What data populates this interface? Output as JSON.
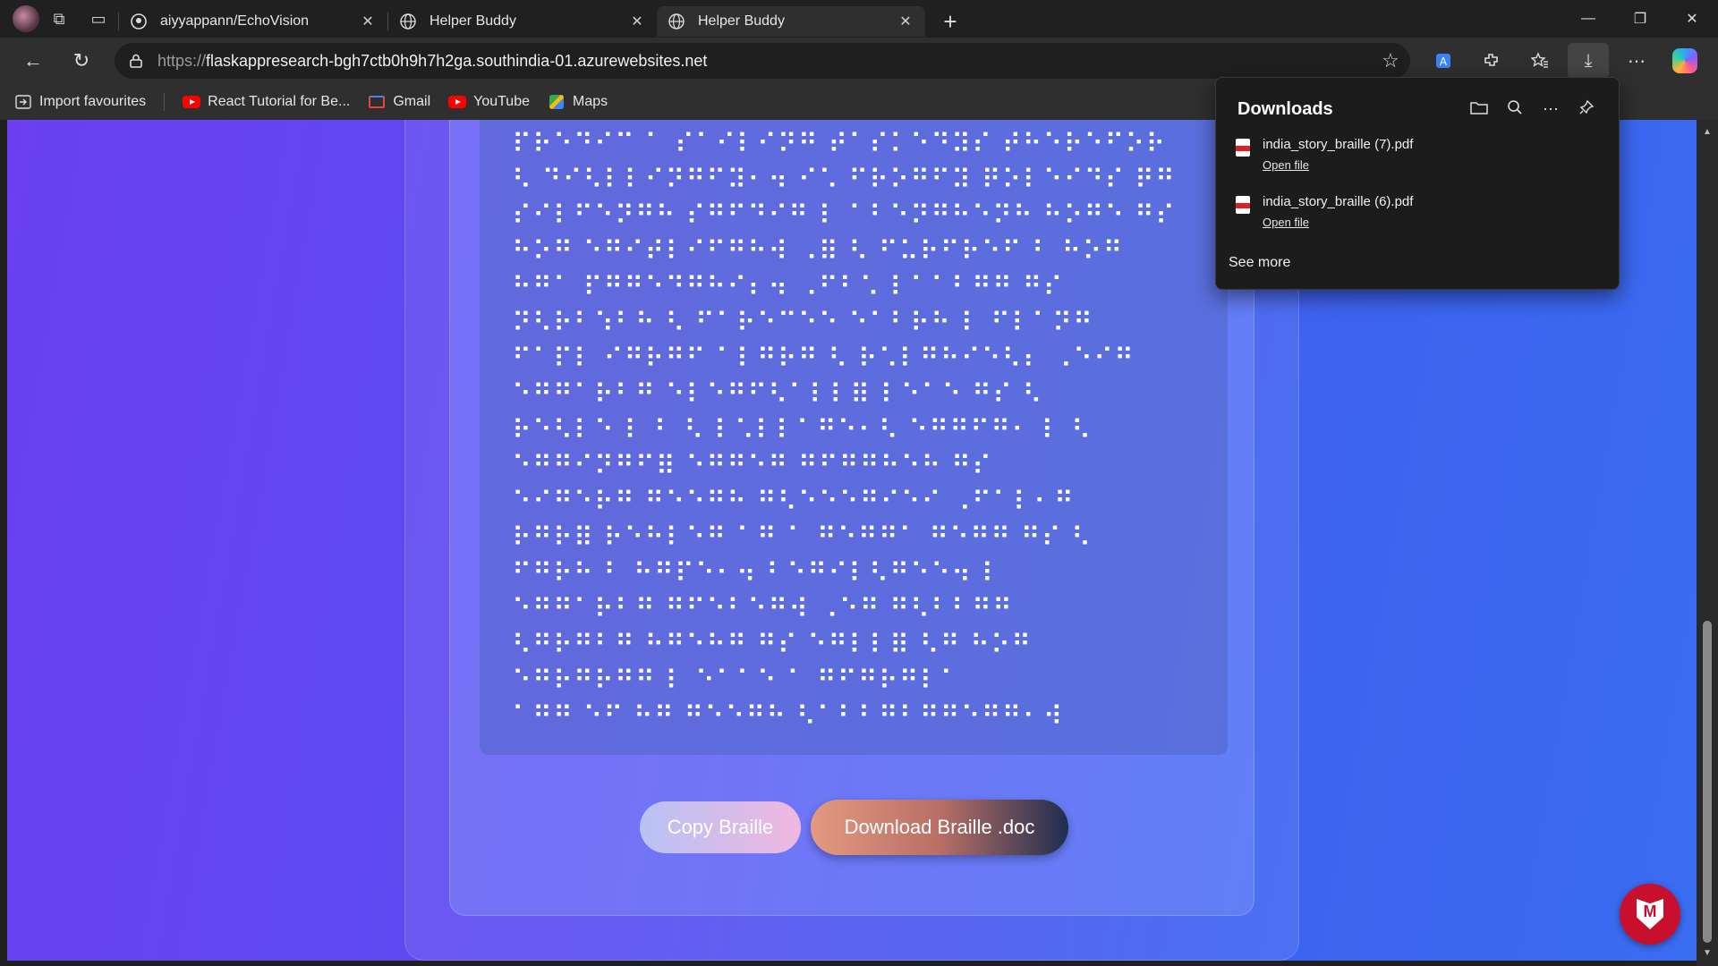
{
  "browser": {
    "tabs": [
      {
        "title": "aiyyappann/EchoVision",
        "icon": "github-icon",
        "active": false
      },
      {
        "title": "Helper Buddy",
        "icon": "globe-icon",
        "active": false
      },
      {
        "title": "Helper Buddy",
        "icon": "globe-icon",
        "active": true
      }
    ],
    "url_protocol": "https://",
    "url_host": "flaskappresearch-bgh7ctb0h9h7h2ga.southindia-01.azurewebsites.net",
    "favourites": [
      {
        "label": "Import favourites",
        "icon": "import-icon"
      },
      {
        "label": "React Tutorial for Be...",
        "icon": "youtube-icon"
      },
      {
        "label": "Gmail",
        "icon": "gmail-icon"
      },
      {
        "label": "YouTube",
        "icon": "youtube-icon"
      },
      {
        "label": "Maps",
        "icon": "maps-icon"
      }
    ]
  },
  "page": {
    "braille_lines": [
      "⠏⠗⠑⠙⠊⠉ ⠁ ⠎⠁⠊⠇⠊⠝⠛ ⠞⠁⠎⠅⠑⠙⠽⠎ ⠞⠓⠑⠗⠑⠋⠕⠗",
      "⠣ ⠙⠊⠣⠇⠇⠊⠝⠛⠋⠽⠂⠲ ⠊⠡ ⠋⠗⠕⠛⠋⠽ ⠟⠕⠇⠑⠊⠙⠎ ⠟⠛",
      "⠎⠊⠇⠋⠑⠝⠛⠓ ⠎⠛⠋⠙⠊⠛ ⠇ ⠁⠃⠑⠝⠛⠓⠑⠝⠓ ⠓⠕⠛⠑ ⠛⠎",
      "⠓⠕⠛ ⠑⠛⠊⠞⠇⠊⠋⠛⠓⠺ ⠠⠿ ⠣ ⠋⠥⠗⠋⠗⠑⠋ ⠃ ⠓⠕⠛",
      "⠓⠛⠁ ⠏⠛⠛⠑⠙⠛⠓⠊⠆⠲ ⠠⠋⠃⠡ ⠇⠁⠁⠃⠛⠛ ⠛⠎",
      "⠝⠣⠗⠃⠱⠃⠓ ⠣ ⠋⠁⠗⠑⠉⠑⠑ ⠑⠁⠃⠗⠓ ⠇ ⠋⠇⠁⠝⠛",
      "⠋⠁⠏⠇ ⠊⠛⠗⠛⠋ ⠁⠇⠛⠗⠛ ⠣ ⠗⠡⠇⠛⠓⠊⠑⠣⠆ ⠠⠑⠊⠛",
      "⠑⠛⠛⠁⠗⠃⠛ ⠑⠇⠑⠛⠋⠣⠁⠇⠇⠿ ⠇⠑⠁⠑ ⠛⠎ ⠣",
      "⠗⠑⠣⠇⠑ ⠇ ⠃ ⠣ ⠇⠡⠇⠇⠁⠛⠑⠂⠣ ⠑⠛⠛⠋⠛⠂ ⠇ ⠣",
      "⠑⠛⠛⠊⠝⠛⠋⠿ ⠑⠛⠛⠑⠛ ⠛⠋⠛⠛⠓⠑⠓ ⠛⠎",
      "⠑⠊⠛⠑⠗⠛ ⠛⠑⠑⠛⠓ ⠛⠣⠑⠑⠑⠛⠊⠑⠊ ⠠⠋⠁⠇⠂⠛",
      "⠗⠛⠗⠿ ⠗⠑⠓⠇⠑⠛ ⠁⠛ ⠁ ⠛⠑⠛⠛⠁ ⠛⠑⠛⠛ ⠛⠎ ⠣",
      "⠋⠛⠗⠓ ⠃ ⠓⠛⠏⠑⠂⠲ ⠃⠑⠛⠊⠇⠣⠛⠑⠑⠲ ⠇",
      "⠑⠛⠛⠁⠗⠃⠛ ⠛⠋⠑⠃⠑⠛⠺ ⠠⠑⠛ ⠛⠣⠃⠃⠛⠛",
      "⠣⠛⠗⠛⠃⠛ ⠓⠛⠑⠓⠛ ⠛⠎ ⠑⠛⠇⠇⠿ ⠣⠛ ⠓⠕⠛",
      "⠑⠛⠗⠛⠗⠛⠛ ⠇ ⠑⠁⠁⠑ ⠁ ⠛⠋⠛⠗⠛⠇⠁",
      "⠁⠛⠛ ⠑⠋ ⠓⠛ ⠛⠑⠑⠛⠓ ⠣⠁⠃⠃⠛⠃⠛⠛⠑⠛⠛⠂⠺"
    ],
    "copy_button": "Copy Braille",
    "download_button": "Download Braille .doc"
  },
  "downloads": {
    "title": "Downloads",
    "items": [
      {
        "filename": "india_story_braille (7).pdf",
        "action": "Open file"
      },
      {
        "filename": "india_story_braille (6).pdf",
        "action": "Open file"
      }
    ],
    "see_more": "See more"
  },
  "scroll_position_fraction": 0.62,
  "icons": {
    "minimize": "—",
    "maximize": "❐",
    "close": "✕",
    "back": "←",
    "refresh": "↻",
    "star": "☆",
    "more": "⋯",
    "download": "⤓",
    "new_tab": "+",
    "tab_close": "✕"
  }
}
